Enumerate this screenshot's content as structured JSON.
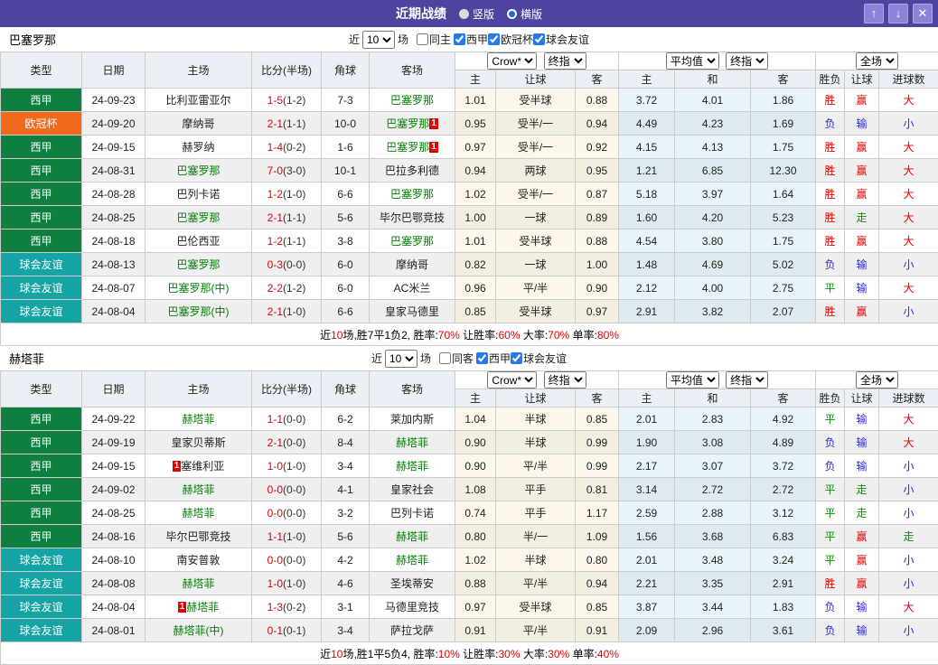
{
  "titlebar": {
    "title": "近期战绩",
    "vertical_label": "竖版",
    "horizontal_label": "横版",
    "vertical_selected": false,
    "horizontal_selected": true,
    "up_icon": "↑",
    "down_icon": "↓",
    "close_icon": "✕"
  },
  "header": {
    "type": "类型",
    "date": "日期",
    "home": "主场",
    "score": "比分(半场)",
    "corner": "角球",
    "away": "客场",
    "crow": "Crow*",
    "final": "终指",
    "avg": "平均值",
    "final2": "终指",
    "full": "全场",
    "sub": [
      "主",
      "让球",
      "客",
      "主",
      "和",
      "客",
      "胜负",
      "让球",
      "进球数"
    ]
  },
  "type_colors": {
    "西甲": "#0f7f40",
    "欧冠杯": "#f26b1d",
    "球会友谊": "#16a3a3"
  },
  "colors": {
    "titlebar_bg": "#4c449e",
    "win_red": "#e30000",
    "lose_blue": "#2a2ad0",
    "draw_green": "#089000",
    "team_green": "#008000"
  },
  "sections": [
    {
      "team": "巴塞罗那",
      "filter": {
        "near": "近",
        "count": "10",
        "games": "场",
        "same_label": "同主",
        "same_checked": false,
        "leagues": [
          "西甲",
          "欧冠杯",
          "球会友谊"
        ]
      },
      "rows": [
        {
          "type": "西甲",
          "date": "24-09-23",
          "home": {
            "text": "比利亚雷亚尔",
            "green": false,
            "rc": ""
          },
          "score": "1-5",
          "half": "(1-2)",
          "corner": "7-3",
          "away": {
            "text": "巴塞罗那",
            "green": true,
            "rc": ""
          },
          "odds": [
            "1.01",
            "受半球",
            "0.88",
            "3.72",
            "4.01",
            "1.86"
          ],
          "results": [
            {
              "text": "胜",
              "color": "red"
            },
            {
              "text": "赢",
              "color": "red"
            },
            {
              "text": "大",
              "color": "red"
            }
          ]
        },
        {
          "type": "欧冠杯",
          "date": "24-09-20",
          "home": {
            "text": "摩纳哥",
            "green": false,
            "rc": ""
          },
          "score": "2-1",
          "half": "(1-1)",
          "corner": "10-0",
          "away": {
            "text": "巴塞罗那",
            "green": true,
            "rc": "after"
          },
          "odds": [
            "0.95",
            "受半/一",
            "0.94",
            "4.49",
            "4.23",
            "1.69"
          ],
          "results": [
            {
              "text": "负",
              "color": "blue"
            },
            {
              "text": "输",
              "color": "blue"
            },
            {
              "text": "小",
              "color": "blue"
            }
          ]
        },
        {
          "type": "西甲",
          "date": "24-09-15",
          "home": {
            "text": "赫罗纳",
            "green": false,
            "rc": ""
          },
          "score": "1-4",
          "half": "(0-2)",
          "corner": "1-6",
          "away": {
            "text": "巴塞罗那",
            "green": true,
            "rc": "after"
          },
          "odds": [
            "0.97",
            "受半/一",
            "0.92",
            "4.15",
            "4.13",
            "1.75"
          ],
          "results": [
            {
              "text": "胜",
              "color": "red"
            },
            {
              "text": "赢",
              "color": "red"
            },
            {
              "text": "大",
              "color": "red"
            }
          ]
        },
        {
          "type": "西甲",
          "date": "24-08-31",
          "home": {
            "text": "巴塞罗那",
            "green": true,
            "rc": ""
          },
          "score": "7-0",
          "half": "(3-0)",
          "corner": "10-1",
          "away": {
            "text": "巴拉多利德",
            "green": false,
            "rc": ""
          },
          "odds": [
            "0.94",
            "两球",
            "0.95",
            "1.21",
            "6.85",
            "12.30"
          ],
          "results": [
            {
              "text": "胜",
              "color": "red"
            },
            {
              "text": "赢",
              "color": "red"
            },
            {
              "text": "大",
              "color": "red"
            }
          ]
        },
        {
          "type": "西甲",
          "date": "24-08-28",
          "home": {
            "text": "巴列卡诺",
            "green": false,
            "rc": ""
          },
          "score": "1-2",
          "half": "(1-0)",
          "corner": "6-6",
          "away": {
            "text": "巴塞罗那",
            "green": true,
            "rc": ""
          },
          "odds": [
            "1.02",
            "受半/一",
            "0.87",
            "5.18",
            "3.97",
            "1.64"
          ],
          "results": [
            {
              "text": "胜",
              "color": "red"
            },
            {
              "text": "赢",
              "color": "red"
            },
            {
              "text": "大",
              "color": "red"
            }
          ]
        },
        {
          "type": "西甲",
          "date": "24-08-25",
          "home": {
            "text": "巴塞罗那",
            "green": true,
            "rc": ""
          },
          "score": "2-1",
          "half": "(1-1)",
          "corner": "5-6",
          "away": {
            "text": "毕尔巴鄂竞技",
            "green": false,
            "rc": ""
          },
          "odds": [
            "1.00",
            "一球",
            "0.89",
            "1.60",
            "4.20",
            "5.23"
          ],
          "results": [
            {
              "text": "胜",
              "color": "red"
            },
            {
              "text": "走",
              "color": "green"
            },
            {
              "text": "大",
              "color": "red"
            }
          ]
        },
        {
          "type": "西甲",
          "date": "24-08-18",
          "home": {
            "text": "巴伦西亚",
            "green": false,
            "rc": ""
          },
          "score": "1-2",
          "half": "(1-1)",
          "corner": "3-8",
          "away": {
            "text": "巴塞罗那",
            "green": true,
            "rc": ""
          },
          "odds": [
            "1.01",
            "受半球",
            "0.88",
            "4.54",
            "3.80",
            "1.75"
          ],
          "results": [
            {
              "text": "胜",
              "color": "red"
            },
            {
              "text": "赢",
              "color": "red"
            },
            {
              "text": "大",
              "color": "red"
            }
          ]
        },
        {
          "type": "球会友谊",
          "date": "24-08-13",
          "home": {
            "text": "巴塞罗那",
            "green": true,
            "rc": ""
          },
          "score": "0-3",
          "half": "(0-0)",
          "corner": "6-0",
          "away": {
            "text": "摩纳哥",
            "green": false,
            "rc": ""
          },
          "odds": [
            "0.82",
            "一球",
            "1.00",
            "1.48",
            "4.69",
            "5.02"
          ],
          "results": [
            {
              "text": "负",
              "color": "blue"
            },
            {
              "text": "输",
              "color": "blue"
            },
            {
              "text": "小",
              "color": "blue"
            }
          ]
        },
        {
          "type": "球会友谊",
          "date": "24-08-07",
          "home": {
            "text": "巴塞罗那(中)",
            "green": true,
            "rc": ""
          },
          "score": "2-2",
          "half": "(1-2)",
          "corner": "6-0",
          "away": {
            "text": "AC米兰",
            "green": false,
            "rc": ""
          },
          "odds": [
            "0.96",
            "平/半",
            "0.90",
            "2.12",
            "4.00",
            "2.75"
          ],
          "results": [
            {
              "text": "平",
              "color": "green"
            },
            {
              "text": "输",
              "color": "blue"
            },
            {
              "text": "大",
              "color": "red"
            }
          ]
        },
        {
          "type": "球会友谊",
          "date": "24-08-04",
          "home": {
            "text": "巴塞罗那(中)",
            "green": true,
            "rc": ""
          },
          "score": "2-1",
          "half": "(1-0)",
          "corner": "6-6",
          "away": {
            "text": "皇家马德里",
            "green": false,
            "rc": ""
          },
          "odds": [
            "0.85",
            "受半球",
            "0.97",
            "2.91",
            "3.82",
            "2.07"
          ],
          "results": [
            {
              "text": "胜",
              "color": "red"
            },
            {
              "text": "赢",
              "color": "red"
            },
            {
              "text": "小",
              "color": "blue"
            }
          ]
        }
      ],
      "summary_parts": [
        "近",
        "10",
        "场,胜7平1负2, 胜率:",
        "70%",
        " 让胜率:",
        "60%",
        " 大率:",
        "70%",
        " 单率:",
        "80%"
      ]
    },
    {
      "team": "赫塔菲",
      "filter": {
        "near": "近",
        "count": "10",
        "games": "场",
        "same_label": "同客",
        "same_checked": false,
        "leagues": [
          "西甲",
          "球会友谊"
        ]
      },
      "rows": [
        {
          "type": "西甲",
          "date": "24-09-22",
          "home": {
            "text": "赫塔菲",
            "green": true,
            "rc": ""
          },
          "score": "1-1",
          "half": "(0-0)",
          "corner": "6-2",
          "away": {
            "text": "莱加内斯",
            "green": false,
            "rc": ""
          },
          "odds": [
            "1.04",
            "半球",
            "0.85",
            "2.01",
            "2.83",
            "4.92"
          ],
          "results": [
            {
              "text": "平",
              "color": "green"
            },
            {
              "text": "输",
              "color": "blue"
            },
            {
              "text": "大",
              "color": "red"
            }
          ]
        },
        {
          "type": "西甲",
          "date": "24-09-19",
          "home": {
            "text": "皇家贝蒂斯",
            "green": false,
            "rc": ""
          },
          "score": "2-1",
          "half": "(0-0)",
          "corner": "8-4",
          "away": {
            "text": "赫塔菲",
            "green": true,
            "rc": ""
          },
          "odds": [
            "0.90",
            "半球",
            "0.99",
            "1.90",
            "3.08",
            "4.89"
          ],
          "results": [
            {
              "text": "负",
              "color": "blue"
            },
            {
              "text": "输",
              "color": "blue"
            },
            {
              "text": "大",
              "color": "red"
            }
          ]
        },
        {
          "type": "西甲",
          "date": "24-09-15",
          "home": {
            "text": "塞维利亚",
            "green": false,
            "rc": "before"
          },
          "score": "1-0",
          "half": "(1-0)",
          "corner": "3-4",
          "away": {
            "text": "赫塔菲",
            "green": true,
            "rc": ""
          },
          "odds": [
            "0.90",
            "平/半",
            "0.99",
            "2.17",
            "3.07",
            "3.72"
          ],
          "results": [
            {
              "text": "负",
              "color": "blue"
            },
            {
              "text": "输",
              "color": "blue"
            },
            {
              "text": "小",
              "color": "blue"
            }
          ]
        },
        {
          "type": "西甲",
          "date": "24-09-02",
          "home": {
            "text": "赫塔菲",
            "green": true,
            "rc": ""
          },
          "score": "0-0",
          "half": "(0-0)",
          "corner": "4-1",
          "away": {
            "text": "皇家社会",
            "green": false,
            "rc": ""
          },
          "odds": [
            "1.08",
            "平手",
            "0.81",
            "3.14",
            "2.72",
            "2.72"
          ],
          "results": [
            {
              "text": "平",
              "color": "green"
            },
            {
              "text": "走",
              "color": "green"
            },
            {
              "text": "小",
              "color": "blue"
            }
          ]
        },
        {
          "type": "西甲",
          "date": "24-08-25",
          "home": {
            "text": "赫塔菲",
            "green": true,
            "rc": ""
          },
          "score": "0-0",
          "half": "(0-0)",
          "corner": "3-2",
          "away": {
            "text": "巴列卡诺",
            "green": false,
            "rc": ""
          },
          "odds": [
            "0.74",
            "平手",
            "1.17",
            "2.59",
            "2.88",
            "3.12"
          ],
          "results": [
            {
              "text": "平",
              "color": "green"
            },
            {
              "text": "走",
              "color": "green"
            },
            {
              "text": "小",
              "color": "blue"
            }
          ]
        },
        {
          "type": "西甲",
          "date": "24-08-16",
          "home": {
            "text": "毕尔巴鄂竞技",
            "green": false,
            "rc": ""
          },
          "score": "1-1",
          "half": "(1-0)",
          "corner": "5-6",
          "away": {
            "text": "赫塔菲",
            "green": true,
            "rc": ""
          },
          "odds": [
            "0.80",
            "半/一",
            "1.09",
            "1.56",
            "3.68",
            "6.83"
          ],
          "results": [
            {
              "text": "平",
              "color": "green"
            },
            {
              "text": "赢",
              "color": "red"
            },
            {
              "text": "走",
              "color": "green"
            }
          ]
        },
        {
          "type": "球会友谊",
          "date": "24-08-10",
          "home": {
            "text": "南安普敦",
            "green": false,
            "rc": ""
          },
          "score": "0-0",
          "half": "(0-0)",
          "corner": "4-2",
          "away": {
            "text": "赫塔菲",
            "green": true,
            "rc": ""
          },
          "odds": [
            "1.02",
            "半球",
            "0.80",
            "2.01",
            "3.48",
            "3.24"
          ],
          "results": [
            {
              "text": "平",
              "color": "green"
            },
            {
              "text": "赢",
              "color": "red"
            },
            {
              "text": "小",
              "color": "blue"
            }
          ]
        },
        {
          "type": "球会友谊",
          "date": "24-08-08",
          "home": {
            "text": "赫塔菲",
            "green": true,
            "rc": ""
          },
          "score": "1-0",
          "half": "(1-0)",
          "corner": "4-6",
          "away": {
            "text": "圣埃蒂安",
            "green": false,
            "rc": ""
          },
          "odds": [
            "0.88",
            "平/半",
            "0.94",
            "2.21",
            "3.35",
            "2.91"
          ],
          "results": [
            {
              "text": "胜",
              "color": "red"
            },
            {
              "text": "赢",
              "color": "red"
            },
            {
              "text": "小",
              "color": "blue"
            }
          ]
        },
        {
          "type": "球会友谊",
          "date": "24-08-04",
          "home": {
            "text": "赫塔菲",
            "green": true,
            "rc": "before"
          },
          "score": "1-3",
          "half": "(0-2)",
          "corner": "3-1",
          "away": {
            "text": "马德里竞技",
            "green": false,
            "rc": ""
          },
          "odds": [
            "0.97",
            "受半球",
            "0.85",
            "3.87",
            "3.44",
            "1.83"
          ],
          "results": [
            {
              "text": "负",
              "color": "blue"
            },
            {
              "text": "输",
              "color": "blue"
            },
            {
              "text": "大",
              "color": "red"
            }
          ]
        },
        {
          "type": "球会友谊",
          "date": "24-08-01",
          "home": {
            "text": "赫塔菲(中)",
            "green": true,
            "rc": ""
          },
          "score": "0-1",
          "half": "(0-1)",
          "corner": "3-4",
          "away": {
            "text": "萨拉戈萨",
            "green": false,
            "rc": ""
          },
          "odds": [
            "0.91",
            "平/半",
            "0.91",
            "2.09",
            "2.96",
            "3.61"
          ],
          "results": [
            {
              "text": "负",
              "color": "blue"
            },
            {
              "text": "输",
              "color": "blue"
            },
            {
              "text": "小",
              "color": "blue"
            }
          ]
        }
      ],
      "summary_parts": [
        "近",
        "10",
        "场,胜1平5负4, 胜率:",
        "10%",
        " 让胜率:",
        "30%",
        " 大率:",
        "30%",
        " 单率:",
        "40%"
      ]
    }
  ]
}
